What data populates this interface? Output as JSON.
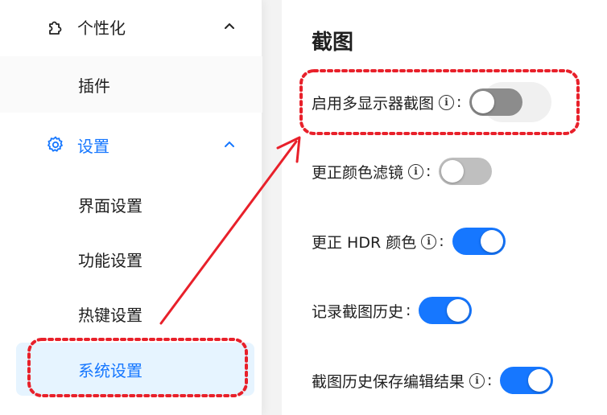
{
  "sidebar": {
    "personalize": {
      "label": "个性化",
      "icon": "puzzle-icon",
      "chevron": "chevron-up-icon"
    },
    "plugins": {
      "label": "插件"
    },
    "settings": {
      "label": "设置",
      "icon": "gear-icon",
      "chevron": "chevron-up-icon"
    },
    "sub_items": [
      {
        "label": "界面设置"
      },
      {
        "label": "功能设置"
      },
      {
        "label": "热键设置"
      },
      {
        "label": "系统设置",
        "selected": true
      }
    ]
  },
  "content": {
    "title": "截图",
    "options": [
      {
        "label": "启用多显示器截图",
        "info": true,
        "enabled": false
      },
      {
        "label": "更正颜色滤镜",
        "info": true,
        "enabled": false
      },
      {
        "label": "更正 HDR 颜色",
        "info": true,
        "enabled": true
      },
      {
        "label": "记录截图历史",
        "info": false,
        "enabled": true
      },
      {
        "label": "截图历史保存编辑结果",
        "info": true,
        "enabled": true
      }
    ],
    "info_glyph": "i",
    "colon": ":"
  },
  "colors": {
    "accent": "#1677ff",
    "selected_bg": "#e6f4ff",
    "toggle_off": "#bfbfbf",
    "annotation_red": "#e8202a"
  }
}
